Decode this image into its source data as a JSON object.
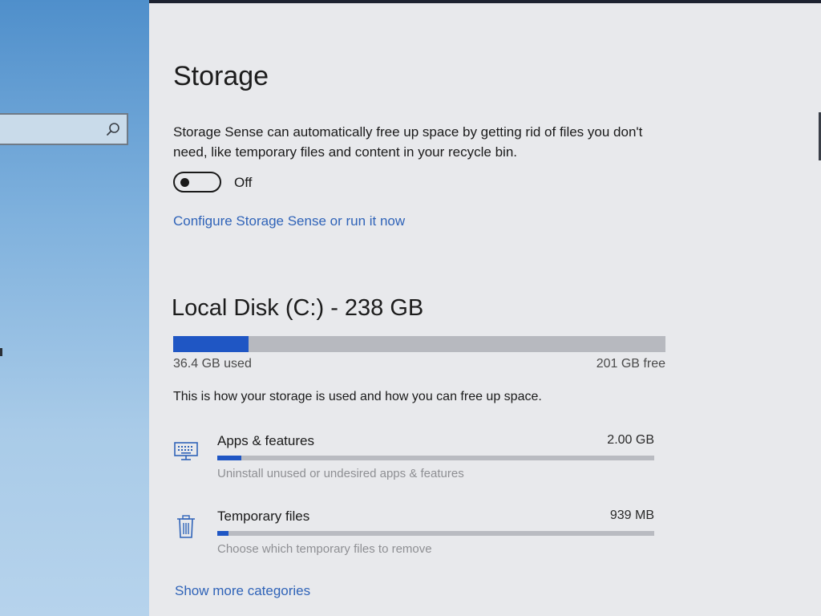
{
  "nav": {
    "search": {
      "value": "",
      "placeholder": "",
      "icon": "search-icon"
    }
  },
  "colors": {
    "accent": "#1f56c4",
    "link": "#2f63b8",
    "nav_background": "#7fb1dd",
    "content_background": "#e8e9ec"
  },
  "storage": {
    "title": "Storage",
    "sense_description": "Storage Sense can automatically free up space by getting rid of files you don't need, like temporary files and content in your recycle bin.",
    "toggle": {
      "state": "off",
      "label": "Off"
    },
    "configure_link": "Configure Storage Sense or run it now"
  },
  "disk": {
    "title": "Local Disk (C:) - 238 GB",
    "used_label": "36.4 GB used",
    "free_label": "201 GB free",
    "used_fraction": 0.153,
    "usage_description": "This is how your storage is used and how you can free up space."
  },
  "categories": [
    {
      "name": "Apps & features",
      "size": "2.00 GB",
      "description": "Uninstall unused or undesired apps & features",
      "icon": "monitor-keyboard-icon",
      "fraction": 0.055
    },
    {
      "name": "Temporary files",
      "size": "939 MB",
      "description": "Choose which temporary files to remove",
      "icon": "trash-icon",
      "fraction": 0.026
    }
  ],
  "show_more_link": "Show more categories"
}
